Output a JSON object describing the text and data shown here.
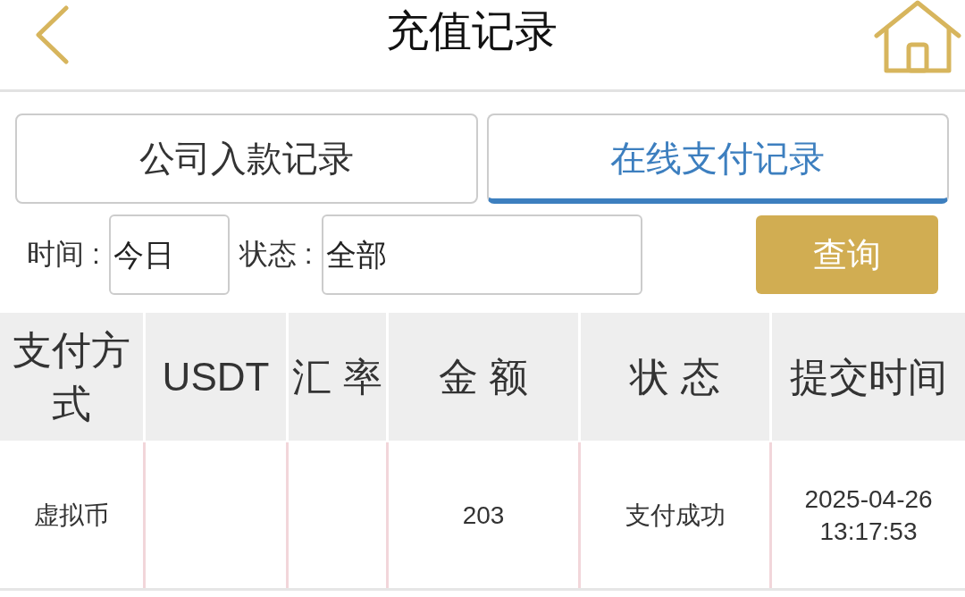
{
  "header": {
    "title": "充值记录"
  },
  "tabs": [
    {
      "label": "公司入款记录",
      "selected": false
    },
    {
      "label": "在线支付记录",
      "selected": true
    }
  ],
  "filters": [
    {
      "label": "时间 :",
      "value": "今日"
    },
    {
      "label": "状态 :",
      "value": "全部"
    }
  ],
  "query_button": "查询",
  "table": {
    "columns": [
      "支付方式",
      "USDT",
      "汇 率",
      "金 额",
      "状 态",
      "提交时间"
    ],
    "rows": [
      {
        "cells": [
          "虚拟币",
          null,
          null,
          "203",
          "支付成功",
          "2025-04-26 13:17:53"
        ]
      }
    ]
  }
}
